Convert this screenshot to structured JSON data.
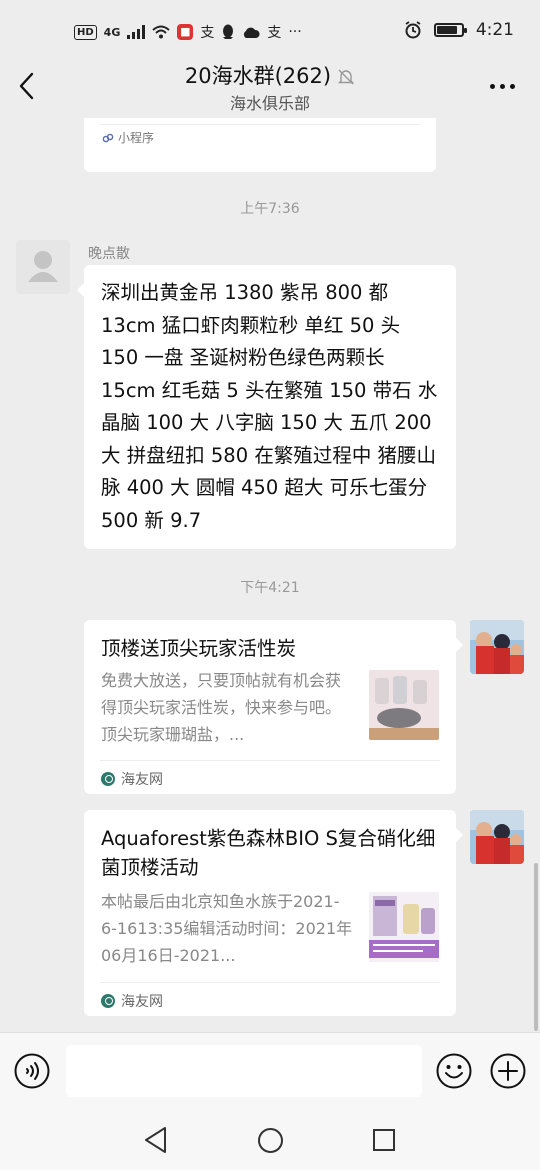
{
  "status_bar": {
    "hd": "HD",
    "network": "4G",
    "app_badge": "支",
    "more": "···",
    "time": "4:21",
    "battery_level": 0.85
  },
  "header": {
    "title": "20海水群(262)",
    "subtitle": "海水俱乐部",
    "icons": [
      "back-arrow-icon",
      "bell-muted-icon",
      "more-dots-icon"
    ]
  },
  "messages": {
    "mini_program": {
      "label": "小程序"
    },
    "time_1": "上午7:36",
    "text_msg": {
      "sender": "晚点散",
      "text": "深圳出黄金吊 1380 紫吊 800 都 13cm 猛口虾肉颗粒秒 单红 50 头 150 一盘 圣诞树粉色绿色两颗长 15cm  红毛菇 5 头在繁殖 150 带石 水晶脑 100 大 八字脑 150 大 五爪 200 大 拼盘纽扣 580 在繁殖过程中 猪腰山脉 400 大 圆帽 450 超大 可乐七蛋分 500 新 9.7"
    },
    "time_2": "下午4:21",
    "card_1": {
      "title": "顶楼送顶尖玩家活性炭",
      "desc": "免费大放送，只要顶帖就有机会获得顶尖玩家活性炭，快来参与吧。顶尖玩家珊瑚盐，...",
      "source": "海友网"
    },
    "card_2": {
      "title": "Aquaforest紫色森林BIO S复合硝化细菌顶楼活动",
      "desc": "本帖最后由北京知鱼水族于2021-6-1613:35编辑活动时间：2021年06月16日-2021...",
      "source": "海友网"
    }
  },
  "colors": {
    "background": "#ededed",
    "bubble": "#ffffff",
    "source_icon": "#2d7a6d"
  }
}
